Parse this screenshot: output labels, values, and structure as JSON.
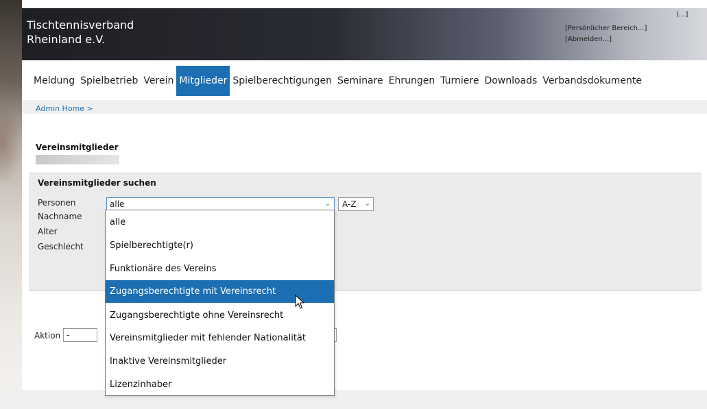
{
  "header": {
    "brand_line1": "Tischtennisverband",
    "brand_line2": "Rheinland e.V.",
    "user_suffix": ")...]",
    "personal_area": "[Persönlicher Bereich...]",
    "logout": "[Abmelden...]"
  },
  "nav": {
    "items": [
      {
        "label": "Meldung"
      },
      {
        "label": "Spielbetrieb"
      },
      {
        "label": "Verein"
      },
      {
        "label": "Mitglieder"
      },
      {
        "label": "Spielberechtigungen"
      },
      {
        "label": "Seminare"
      },
      {
        "label": "Ehrungen"
      },
      {
        "label": "Turniere"
      },
      {
        "label": "Downloads"
      },
      {
        "label": "Verbandsdokumente"
      }
    ],
    "active": "Mitglieder"
  },
  "breadcrumb": "Admin Home >",
  "page_title": "Vereinsmitglieder",
  "search": {
    "title": "Vereinsmitglieder suchen",
    "labels": {
      "personen": "Personen",
      "nachname": "Nachname",
      "alter": "Alter",
      "geschlecht": "Geschlecht"
    },
    "personen_value": "alle",
    "sort_value": "A-Z"
  },
  "action": {
    "label": "Aktion",
    "value": "-"
  },
  "dropdown": {
    "options": [
      "alle",
      "Spielberechtigte(r)",
      "Funktionäre des Vereins",
      "Zugangsberechtigte mit Vereinsrecht",
      "Zugangsberechtigte ohne Vereinsrecht",
      "Vereinsmitglieder mit fehlender Nationalität",
      "Inaktive Vereinsmitglieder",
      "Lizenzinhaber"
    ],
    "highlighted": "Zugangsberechtigte mit Vereinsrecht"
  },
  "colors": {
    "accent": "#1c6fb3",
    "panel": "#ebebeb"
  }
}
